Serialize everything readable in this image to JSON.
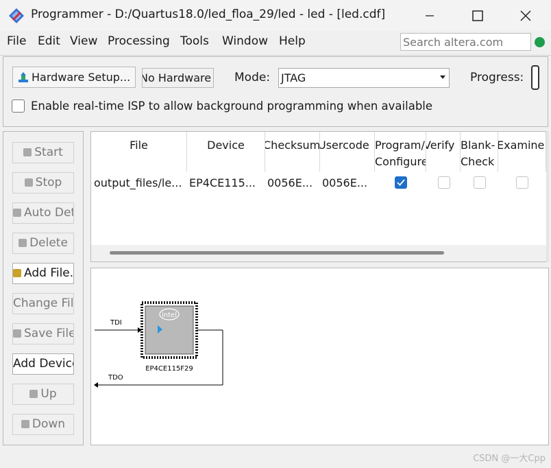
{
  "window": {
    "title": "Programmer - D:/Quartus18.0/led_floa_29/led - led - [led.cdf]",
    "icon": "quartus-programmer-icon",
    "controls": [
      "minimize-icon",
      "maximize-icon",
      "close-icon"
    ]
  },
  "menu": {
    "items": [
      "File",
      "Edit",
      "View",
      "Processing",
      "Tools",
      "Window",
      "Help"
    ],
    "search_placeholder": "Search altera.com"
  },
  "toolbar": {
    "hardware_setup": "Hardware Setup...",
    "hardware_status": "No Hardware",
    "mode_label": "Mode:",
    "mode_value": "JTAG",
    "progress_label": "Progress:",
    "isp_label": "Enable real-time ISP to allow background programming when available",
    "isp_checked": false
  },
  "side_buttons": [
    {
      "label": "Start",
      "icon": "start-icon",
      "enabled": false
    },
    {
      "label": "Stop",
      "icon": "stop-icon",
      "enabled": false
    },
    {
      "label": "Auto Detect",
      "icon": "auto-detect-icon",
      "enabled": false
    },
    {
      "label": "Delete",
      "icon": "delete-icon",
      "enabled": false
    },
    {
      "label": "Add File...",
      "icon": "add-file-icon",
      "enabled": true
    },
    {
      "label": "Change File...",
      "icon": "",
      "enabled": false
    },
    {
      "label": "Save File",
      "icon": "save-icon",
      "enabled": false
    },
    {
      "label": "Add Device...",
      "icon": "",
      "enabled": true
    },
    {
      "label": "Up",
      "icon": "up-icon",
      "enabled": false
    },
    {
      "label": "Down",
      "icon": "down-icon",
      "enabled": false
    }
  ],
  "table": {
    "headers": [
      "File",
      "Device",
      "Checksum",
      "Usercode",
      "Program/\nConfigure",
      "Verify",
      "Blank-\nCheck",
      "Examine"
    ],
    "rows": [
      {
        "file": "output_files/le...",
        "device": "EP4CE115...",
        "checksum": "0056E...",
        "usercode": "0056E...",
        "program": true,
        "verify": false,
        "blank_check": false,
        "examine": false
      }
    ]
  },
  "diagram": {
    "tdi_label": "TDI",
    "tdo_label": "TDO",
    "chip_label": "EP4CE115F29",
    "chip_logo": "intel"
  },
  "watermark": "CSDN @一大Cpp",
  "colors": {
    "accent": "#1e6fc9",
    "arrow": "#2b94e0"
  }
}
